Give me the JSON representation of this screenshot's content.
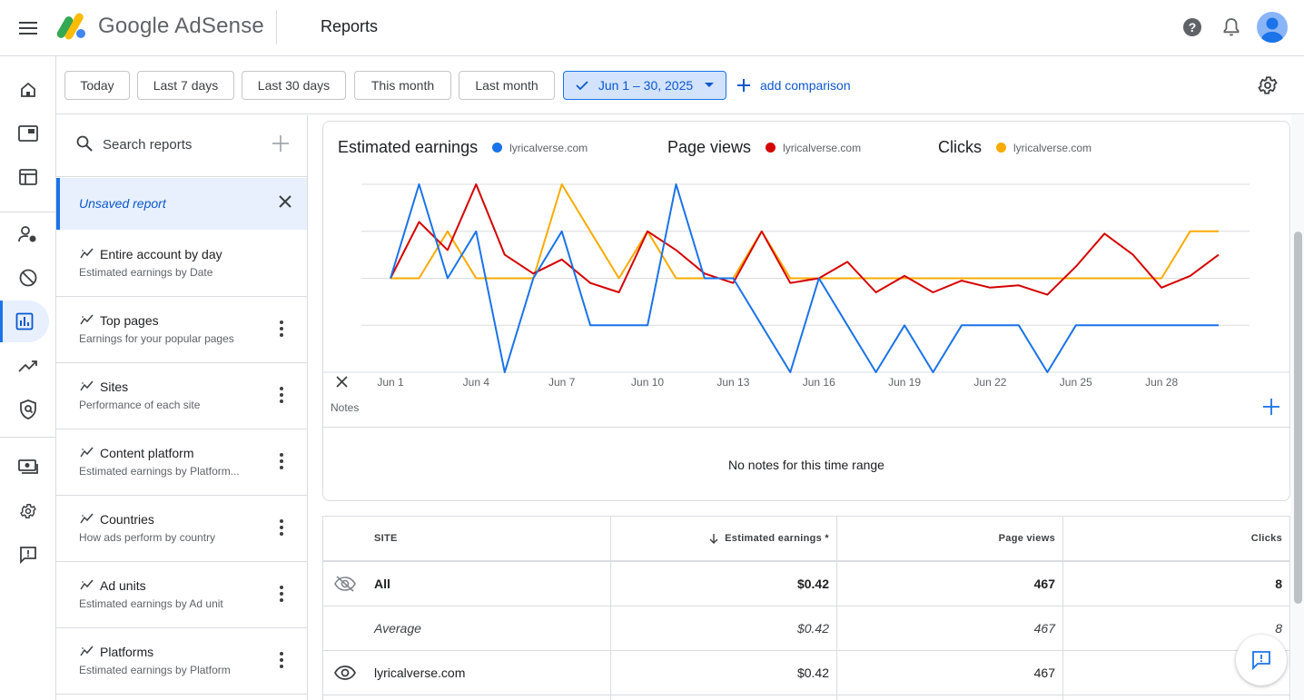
{
  "app": {
    "logo_text": "Google AdSense",
    "page_title": "Reports"
  },
  "date_filters": {
    "chips": [
      "Today",
      "Last 7 days",
      "Last 30 days",
      "This month",
      "Last month"
    ],
    "selected": "Jun 1 – 30, 2025",
    "add_comparison": "add comparison"
  },
  "reports": {
    "search_placeholder": "Search reports",
    "unsaved": "Unsaved report",
    "items": [
      {
        "title": "Entire account by day",
        "subtitle": "Estimated earnings by Date"
      },
      {
        "title": "Top pages",
        "subtitle": "Earnings for your popular pages"
      },
      {
        "title": "Sites",
        "subtitle": "Performance of each site"
      },
      {
        "title": "Content platform",
        "subtitle": "Estimated earnings by Platform..."
      },
      {
        "title": "Countries",
        "subtitle": "How ads perform by country"
      },
      {
        "title": "Ad units",
        "subtitle": "Estimated earnings by Ad unit"
      },
      {
        "title": "Platforms",
        "subtitle": "Estimated earnings by Platform"
      }
    ]
  },
  "chart": {
    "legend": [
      {
        "metric": "Estimated earnings",
        "site": "lyricalverse.com",
        "color": "#1a73e8"
      },
      {
        "metric": "Page views",
        "site": "lyricalverse.com",
        "color": "#d50000"
      },
      {
        "metric": "Clicks",
        "site": "lyricalverse.com",
        "color": "#f9ab00"
      }
    ],
    "x_labels": [
      "Jun 1",
      "Jun 4",
      "Jun 7",
      "Jun 10",
      "Jun 13",
      "Jun 16",
      "Jun 19",
      "Jun 22",
      "Jun 25",
      "Jun 28"
    ],
    "notes_label": "Notes",
    "notes_empty": "No notes for this time range"
  },
  "chart_data": {
    "type": "line",
    "x": [
      "Jun 1",
      "Jun 2",
      "Jun 3",
      "Jun 4",
      "Jun 5",
      "Jun 6",
      "Jun 7",
      "Jun 8",
      "Jun 9",
      "Jun 10",
      "Jun 11",
      "Jun 12",
      "Jun 13",
      "Jun 14",
      "Jun 15",
      "Jun 16",
      "Jun 17",
      "Jun 18",
      "Jun 19",
      "Jun 20",
      "Jun 21",
      "Jun 22",
      "Jun 23",
      "Jun 24",
      "Jun 25",
      "Jun 26",
      "Jun 27",
      "Jun 28",
      "Jun 29",
      "Jun 30"
    ],
    "ylim": [
      0,
      4
    ],
    "grid": true,
    "series": [
      {
        "name": "Estimated earnings",
        "color": "#1a73e8",
        "values": [
          2,
          4,
          2,
          3,
          0,
          2,
          3,
          1,
          1,
          1,
          4,
          2,
          2,
          1,
          0,
          2,
          1,
          0,
          1,
          0,
          1,
          1,
          1,
          0,
          1,
          1,
          1,
          1,
          1,
          1
        ]
      },
      {
        "name": "Page views",
        "color": "#d50000",
        "values": [
          2,
          3.2,
          2.6,
          4,
          2.5,
          2.1,
          2.4,
          1.9,
          1.7,
          3,
          2.6,
          2.1,
          1.9,
          3,
          1.9,
          2,
          2.35,
          1.7,
          2.05,
          1.7,
          1.95,
          1.8,
          1.85,
          1.65,
          2.25,
          2.95,
          2.5,
          1.8,
          2.05,
          2.5
        ]
      },
      {
        "name": "Clicks",
        "color": "#f9ab00",
        "values": [
          2,
          2,
          3,
          2,
          2,
          2,
          4,
          3,
          2,
          3,
          2,
          2,
          2,
          3,
          2,
          2,
          2,
          2,
          2,
          2,
          2,
          2,
          2,
          2,
          2,
          2,
          2,
          2,
          3,
          3
        ]
      }
    ]
  },
  "table": {
    "headers": {
      "site": "SITE",
      "earnings": "Estimated earnings *",
      "views": "Page views",
      "clicks": "Clicks"
    },
    "rows": [
      {
        "site": "All",
        "earnings": "$0.42",
        "views": "467",
        "clicks": "8"
      },
      {
        "site": "Average",
        "earnings": "$0.42",
        "views": "467",
        "clicks": "8"
      },
      {
        "site": "lyricalverse.com",
        "earnings": "$0.42",
        "views": "467",
        "clicks": ""
      }
    ]
  }
}
